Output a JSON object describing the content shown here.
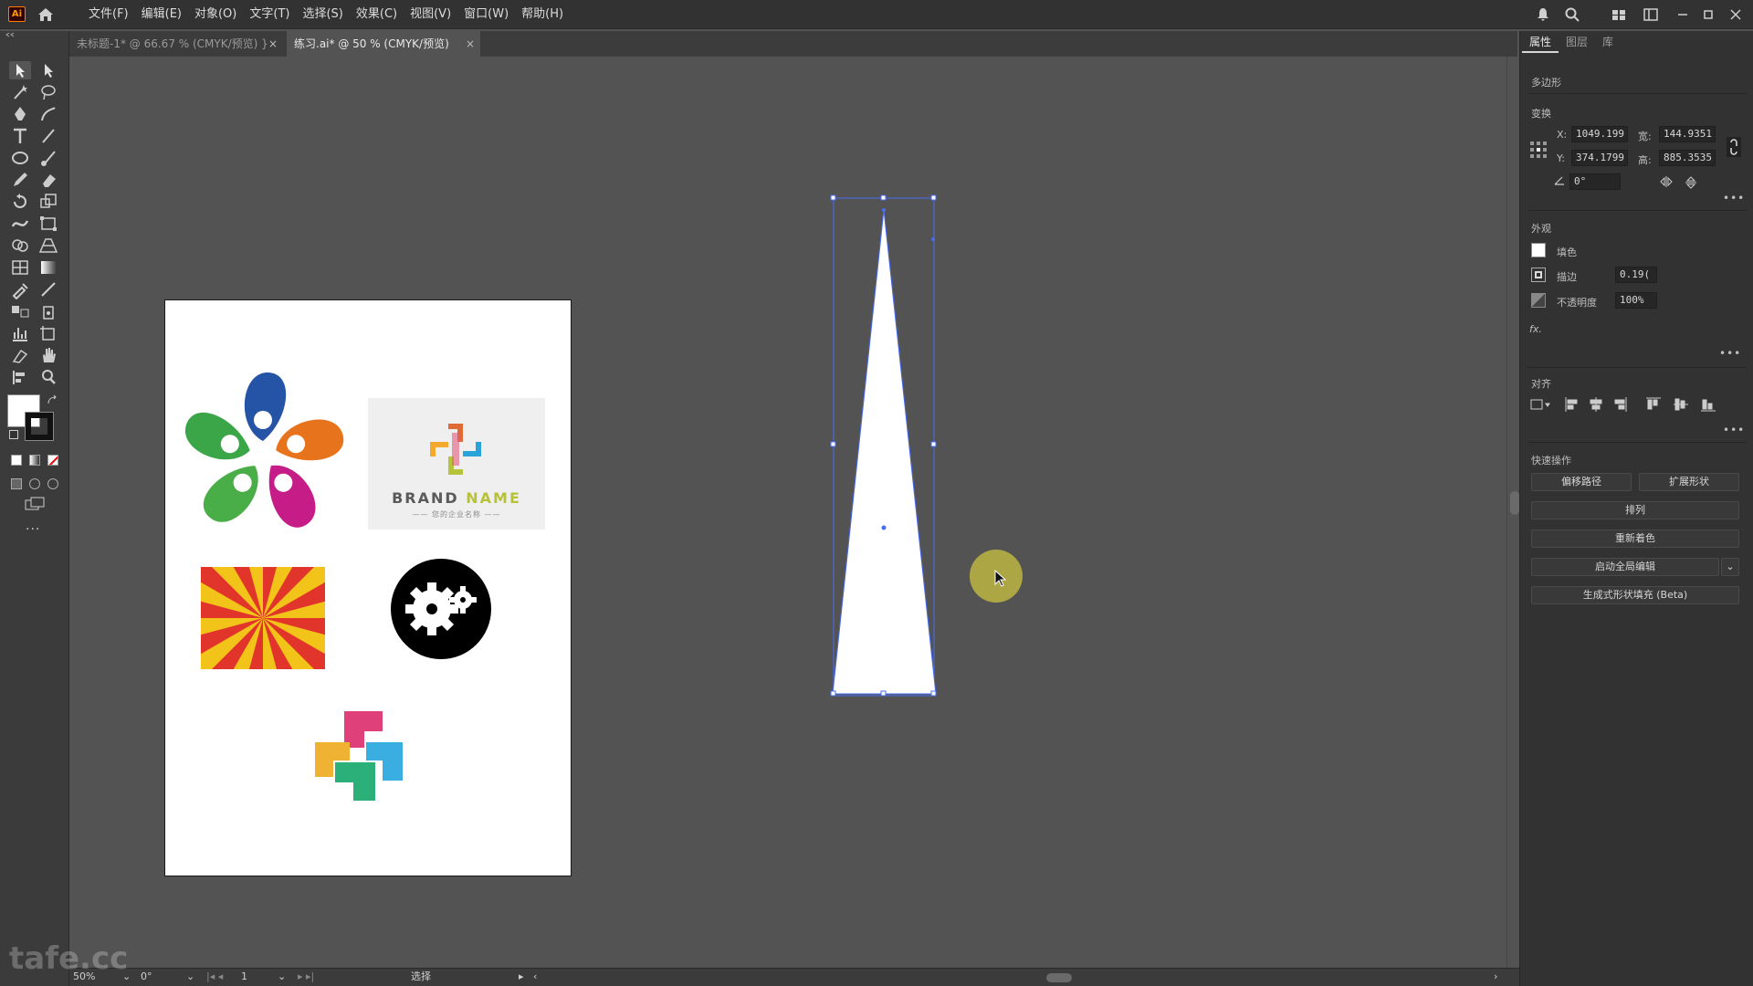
{
  "app": {
    "logo": "Ai"
  },
  "menu": [
    "文件(F)",
    "编辑(E)",
    "对象(O)",
    "文字(T)",
    "选择(S)",
    "效果(C)",
    "视图(V)",
    "窗口(W)",
    "帮助(H)"
  ],
  "tabs": [
    {
      "label": "未标题-1* @ 66.67 % (CMYK/预览)",
      "close": "×"
    },
    {
      "label": "练习.ai* @ 50 % (CMYK/预览)",
      "close": "×"
    }
  ],
  "artboard": {
    "brand": {
      "word1": "BRAND",
      "word2": "NAME",
      "subtitle": "—— 您的企业名称 ——"
    }
  },
  "panel": {
    "tabs": [
      "属性",
      "图层",
      "库"
    ],
    "object_type": "多边形",
    "transform": {
      "title": "变换",
      "x_label": "X:",
      "x_value": "1049.199",
      "y_label": "Y:",
      "y_value": "374.1799",
      "w_label": "宽:",
      "w_value": "144.9351",
      "h_label": "高:",
      "h_value": "885.3535",
      "angle_value": "0°"
    },
    "appearance": {
      "title": "外观",
      "fill_label": "填色",
      "stroke_label": "描边",
      "stroke_value": "0.19(",
      "opacity_label": "不透明度",
      "opacity_value": "100%",
      "fx": "fx."
    },
    "align": {
      "title": "对齐"
    },
    "quick": {
      "title": "快速操作",
      "offset_path": "偏移路径",
      "expand_shape": "扩展形状",
      "arrange": "排列",
      "recolor": "重新着色",
      "global_edit": "启动全局编辑",
      "generative_fill": "生成式形状填充 (Beta)"
    }
  },
  "status": {
    "zoom": "50%",
    "rotation": "0°",
    "artboard_number": "1",
    "tool": "选择"
  },
  "watermark": "tafe.cc",
  "colors": {
    "selection": "#3b6bff",
    "cursor_highlight": "#c8c03a",
    "toolbar_bg": "#3b3b3b",
    "canvas_bg": "#535353"
  }
}
